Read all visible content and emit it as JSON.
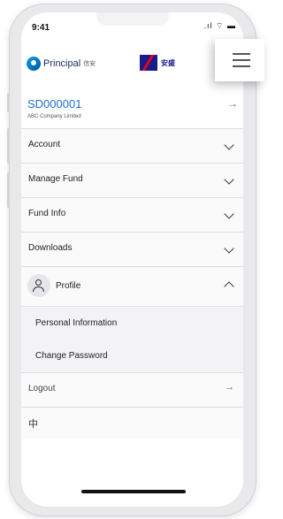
{
  "status_bar": {
    "time": "9:41",
    "icons": ".ıl ⌔ ▬"
  },
  "header": {
    "brand_principal": "Principal",
    "brand_principal_cn": "信安",
    "brand_axa_cn": "安盛"
  },
  "account": {
    "id": "SD000001",
    "company": "ABC Company Limited",
    "arrow": "→"
  },
  "menu": {
    "items": [
      {
        "label": "Account"
      },
      {
        "label": "Manage Fund"
      },
      {
        "label": "Fund Info"
      },
      {
        "label": "Downloads"
      }
    ],
    "profile": {
      "label": "Profile",
      "submenu": [
        {
          "label": "Personal Information"
        },
        {
          "label": "Change Password"
        }
      ]
    },
    "logout": {
      "label": "Logout",
      "arrow": "→"
    },
    "language": {
      "label": "中"
    }
  },
  "colors": {
    "accent": "#1f6fd1",
    "axa_blue": "#1a1a8c",
    "axa_red": "#e30613"
  }
}
